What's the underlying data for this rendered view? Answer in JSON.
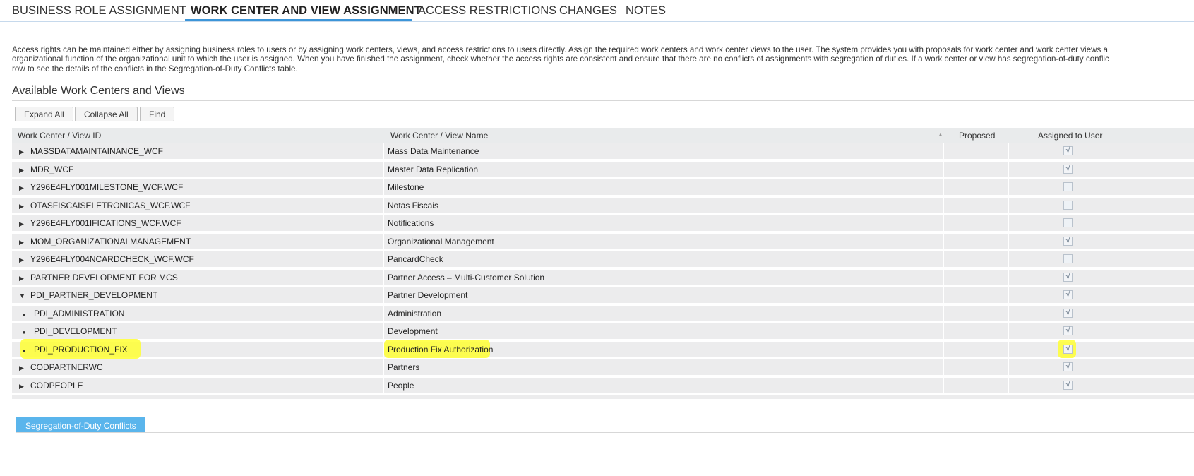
{
  "tabs": [
    {
      "label": "BUSINESS ROLE ASSIGNMENT",
      "active": false
    },
    {
      "label": "WORK CENTER AND VIEW ASSIGNMENT",
      "active": true
    },
    {
      "label": "ACCESS RESTRICTIONS",
      "active": false
    },
    {
      "label": "CHANGES",
      "active": false
    },
    {
      "label": "NOTES",
      "active": false
    }
  ],
  "description": {
    "line1": "Access rights can be maintained either by assigning business roles to users or by assigning work centers, views, and access restrictions to users directly. Assign the required work centers and work center views to the user. The system provides you with proposals for work center and work center views a",
    "line2": "organizational function of the organizational unit to which the user is assigned. When you have finished the assignment, check whether the access rights are consistent and ensure that there are no conflicts of assignments with segregation of duties. If a work center or view has segregation-of-duty conflic",
    "line3": "row to see the details of the conflicts in the Segregation-of-Duty Conflicts table."
  },
  "section_title": "Available Work Centers and Views",
  "toolbar": {
    "expand_all": "Expand All",
    "collapse_all": "Collapse All",
    "find": "Find"
  },
  "table": {
    "headers": {
      "id": "Work Center / View ID",
      "name": "Work Center / View Name",
      "proposed": "Proposed",
      "assigned": "Assigned to User"
    },
    "rows": [
      {
        "id": "MASSDATAMAINTAINANCE_WCF",
        "name": "Mass Data Maintenance",
        "assigned": true,
        "level": 0,
        "expanded": false
      },
      {
        "id": "MDR_WCF",
        "name": "Master Data Replication",
        "assigned": true,
        "level": 0,
        "expanded": false
      },
      {
        "id": "Y296E4FLY001MILESTONE_WCF.WCF",
        "name": "Milestone",
        "assigned": false,
        "level": 0,
        "expanded": false
      },
      {
        "id": "OTASFISCAISELETRONICAS_WCF.WCF",
        "name": "Notas Fiscais",
        "assigned": false,
        "level": 0,
        "expanded": false
      },
      {
        "id": "Y296E4FLY001IFICATIONS_WCF.WCF",
        "name": "Notifications",
        "assigned": false,
        "level": 0,
        "expanded": false
      },
      {
        "id": "MOM_ORGANIZATIONALMANAGEMENT",
        "name": "Organizational Management",
        "assigned": true,
        "level": 0,
        "expanded": false
      },
      {
        "id": "Y296E4FLY004NCARDCHECK_WCF.WCF",
        "name": "PancardCheck",
        "assigned": false,
        "level": 0,
        "expanded": false
      },
      {
        "id": "PARTNER DEVELOPMENT FOR MCS",
        "name": "Partner Access – Multi-Customer Solution",
        "assigned": true,
        "level": 0,
        "expanded": false
      },
      {
        "id": "PDI_PARTNER_DEVELOPMENT",
        "name": "Partner Development",
        "assigned": true,
        "level": 0,
        "expanded": true
      },
      {
        "id": "PDI_ADMINISTRATION",
        "name": "Administration",
        "assigned": true,
        "level": 1
      },
      {
        "id": "PDI_DEVELOPMENT",
        "name": "Development",
        "assigned": true,
        "level": 1
      },
      {
        "id": "PDI_PRODUCTION_FIX",
        "name": "Production Fix Authorization",
        "assigned": true,
        "level": 1,
        "highlighted": true
      },
      {
        "id": "CODPARTNERWC",
        "name": "Partners",
        "assigned": true,
        "level": 0,
        "expanded": false
      },
      {
        "id": "CODPEOPLE",
        "name": "People",
        "assigned": true,
        "level": 0,
        "expanded": false
      }
    ]
  },
  "sod_tab_label": "Segregation-of-Duty Conflicts",
  "colors": {
    "accent": "#3c95d8",
    "sod_tab": "#5ab5ec",
    "row_bg": "#ececed",
    "highlight": "#ffff33"
  }
}
